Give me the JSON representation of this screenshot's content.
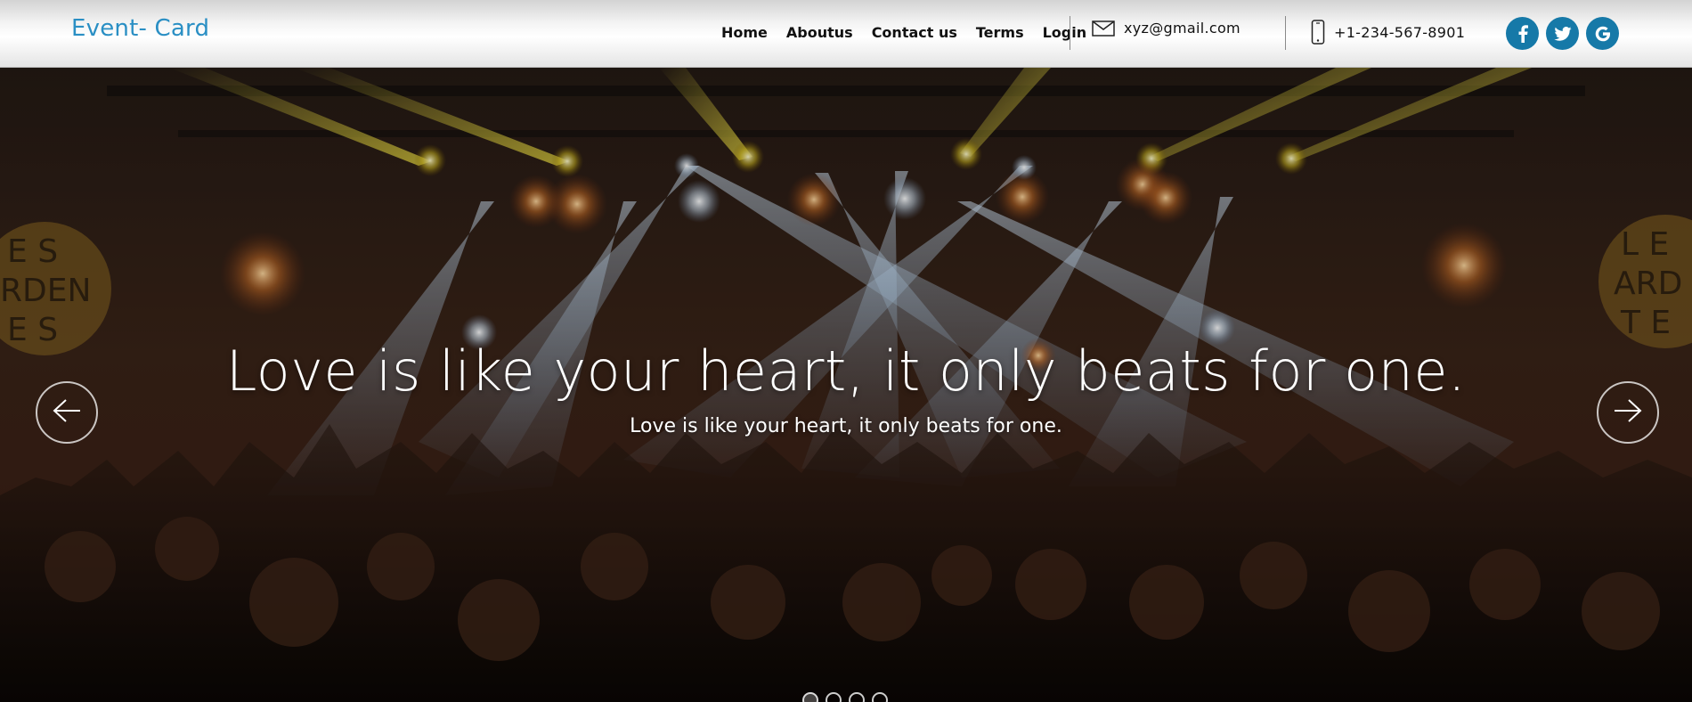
{
  "header": {
    "logo": "Event- Card",
    "nav": [
      "Home",
      "Aboutus",
      "Contact us",
      "Terms",
      "Login"
    ],
    "email": {
      "icon": "envelope-icon",
      "text": "xyz@gmail.com"
    },
    "phone": {
      "icon": "mobile-phone-icon",
      "text": "+1-234-567-8901"
    },
    "social": [
      {
        "icon": "facebook-icon",
        "glyph": "f"
      },
      {
        "icon": "twitter-icon",
        "glyph": "t"
      },
      {
        "icon": "google-icon",
        "glyph": "G"
      }
    ]
  },
  "hero": {
    "title": "Love is like your heart, it only beats for one.",
    "subtitle": "Love is like your heart, it only beats for one.",
    "prev_icon": "arrow-left-icon",
    "next_icon": "arrow-right-icon",
    "slides_count": 4,
    "active_slide": 1
  },
  "colors": {
    "brand": "#2a8fc4",
    "social_bg": "#1679a8",
    "header_bg": "#f0f0f0"
  }
}
